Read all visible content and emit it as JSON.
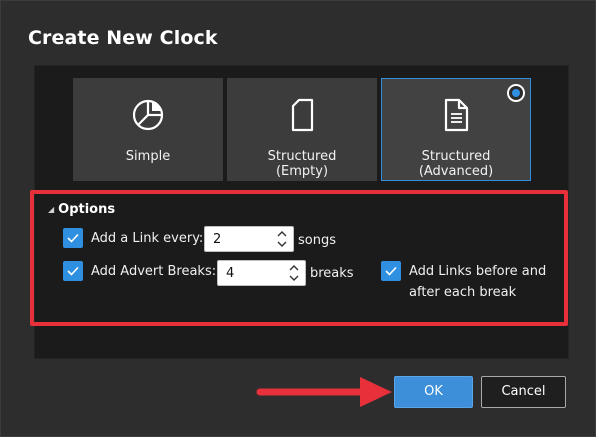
{
  "dialog": {
    "title": "Create New Clock"
  },
  "templates": [
    {
      "label": "Simple",
      "icon": "pie-chart-icon",
      "selected": false
    },
    {
      "label": "Structured\n(Empty)",
      "icon": "blank-page-icon",
      "selected": false
    },
    {
      "label": "Structured\n(Advanced)",
      "icon": "document-icon",
      "selected": true
    }
  ],
  "options": {
    "header": "Options",
    "link_every": {
      "label": "Add a Link every:",
      "value": "2",
      "suffix": "songs",
      "checked": true
    },
    "advert_breaks": {
      "label": "Add Advert Breaks:",
      "value": "4",
      "suffix": "breaks",
      "checked": true
    },
    "links_around_break": {
      "label_line1": "Add Links before and",
      "label_line2": "after each break",
      "checked": true
    }
  },
  "buttons": {
    "ok": "OK",
    "cancel": "Cancel"
  },
  "colors": {
    "accent": "#2f8fe0",
    "highlight": "#e8303a",
    "background": "#2d2d2d",
    "panel": "#1b1b1b"
  }
}
